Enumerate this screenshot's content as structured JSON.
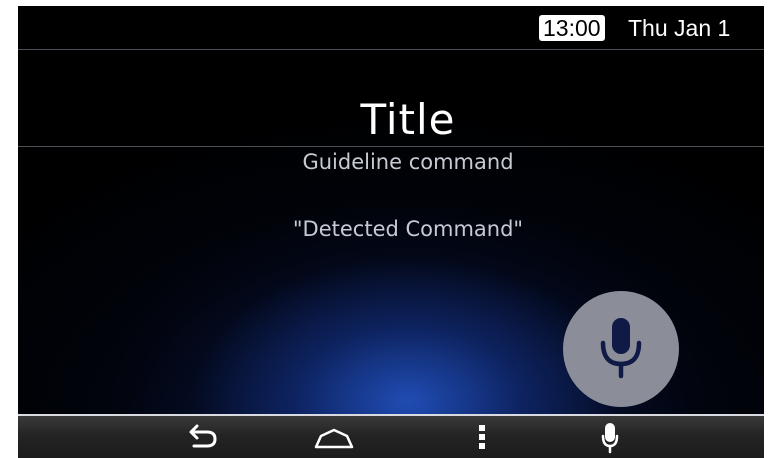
{
  "status_bar": {
    "time": "13:00",
    "date": "Thu Jan 1"
  },
  "voice_screen": {
    "title": "Title",
    "guideline": "Guideline command",
    "detected_command": "\"Detected Command\"",
    "mic_icon": "microphone-icon"
  },
  "nav_bar": {
    "icons": [
      "back-icon",
      "home-icon",
      "menu-icon",
      "microphone-icon"
    ]
  },
  "colors": {
    "background": "#000000",
    "glow": "#2456c8",
    "mic_button": "#8b8e99",
    "text_secondary": "#c6cbd3"
  }
}
